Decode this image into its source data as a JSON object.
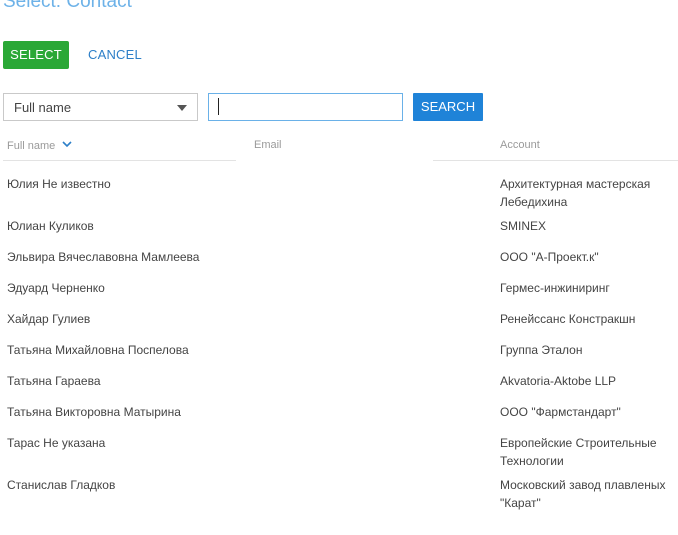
{
  "page": {
    "title": "Select: Contact"
  },
  "toolbar": {
    "select_label": "SELECT",
    "cancel_label": "CANCEL"
  },
  "filter": {
    "column_value": "Full name",
    "search_value": "",
    "search_label": "SEARCH"
  },
  "columns": {
    "full_name": "Full name",
    "email": "Email",
    "account": "Account",
    "sorted_by": "full_name",
    "sort_direction": "descending"
  },
  "rows": [
    {
      "full_name": "Юлия Не известно",
      "email": "",
      "account": "Архитектурная мастерская Лебедихина"
    },
    {
      "full_name": "Юлиан Куликов",
      "email": "",
      "account": "SMINEX"
    },
    {
      "full_name": "Эльвира Вячеславовна Мамлеева",
      "email": "",
      "account": "ООО \"А-Проект.к\""
    },
    {
      "full_name": "Эдуард Черненко",
      "email": "",
      "account": "Гермес-инжиниринг"
    },
    {
      "full_name": "Хайдар Гулиев",
      "email": "",
      "account": "Ренейссанс Констракшн"
    },
    {
      "full_name": "Татьяна Михайловна Поспелова",
      "email": "",
      "account": "Группа Эталон"
    },
    {
      "full_name": "Татьяна Гараева",
      "email": "",
      "account": "Akvatoria-Aktobe LLP"
    },
    {
      "full_name": "Татьяна Викторовна Матырина",
      "email": "",
      "account": "ООО \"Фармстандарт\""
    },
    {
      "full_name": "Тарас Не указана",
      "email": "",
      "account": "Европейские Строительные Технологии"
    },
    {
      "full_name": "Станислав Гладков",
      "email": "",
      "account": "Московский завод плавленых \"Карат\""
    },
    {
      "full_name": "",
      "email": "",
      "account": ""
    }
  ],
  "colors": {
    "title": "#6db2e8",
    "select_button": "#2aa836",
    "cancel_link": "#2d7fc8",
    "search_button": "#1f83d8",
    "input_border": "#6ab1e8"
  }
}
